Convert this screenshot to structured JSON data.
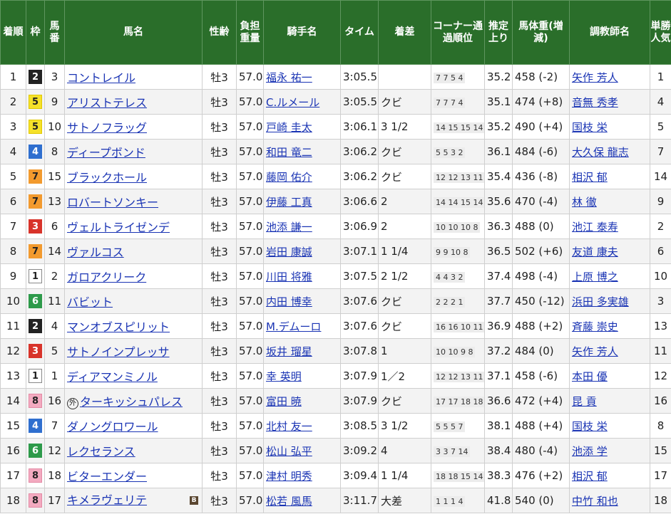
{
  "headers": {
    "rank": "着順",
    "waku": "枠",
    "umaban": "馬番",
    "horse": "馬名",
    "sexage": "性齢",
    "weight": "負担重量",
    "jockey": "騎手名",
    "time": "タイム",
    "margin": "着差",
    "corner": "コーナー通過順位",
    "last3f": "推定上り",
    "bodyweight": "馬体重(増減)",
    "trainer": "調教師名",
    "pop": "単勝人気"
  },
  "waku_colors": {
    "1": {
      "bg": "#ffffff",
      "fg": "#222222",
      "border": "#888888"
    },
    "2": {
      "bg": "#222222",
      "fg": "#ffffff",
      "border": "#222222"
    },
    "3": {
      "bg": "#d8332a",
      "fg": "#ffffff",
      "border": "#d8332a"
    },
    "4": {
      "bg": "#2f6fcf",
      "fg": "#ffffff",
      "border": "#2f6fcf"
    },
    "5": {
      "bg": "#f5e12a",
      "fg": "#222222",
      "border": "#e0c800"
    },
    "6": {
      "bg": "#2d9a4a",
      "fg": "#ffffff",
      "border": "#2d9a4a"
    },
    "7": {
      "bg": "#f29a2e",
      "fg": "#222222",
      "border": "#f29a2e"
    },
    "8": {
      "bg": "#f3aac0",
      "fg": "#222222",
      "border": "#e48aa5"
    }
  },
  "rows": [
    {
      "rank": "1",
      "waku": "2",
      "umaban": "3",
      "horse": "コントレイル",
      "sexage": "牡3",
      "weight": "57.0",
      "jockey": "福永 祐一",
      "time": "3:05.5",
      "margin": "",
      "corner": "7 7 5 4",
      "last3f": "35.2",
      "bodyweight": "458 (-2)",
      "trainer": "矢作 芳人",
      "pop": "1"
    },
    {
      "rank": "2",
      "waku": "5",
      "umaban": "9",
      "horse": "アリストテレス",
      "sexage": "牡3",
      "weight": "57.0",
      "jockey": "C.ルメール",
      "time": "3:05.5",
      "margin": "クビ",
      "corner": "7 7 7 4",
      "last3f": "35.1",
      "bodyweight": "474 (+8)",
      "trainer": "音無 秀孝",
      "pop": "4"
    },
    {
      "rank": "3",
      "waku": "5",
      "umaban": "10",
      "horse": "サトノフラッグ",
      "sexage": "牡3",
      "weight": "57.0",
      "jockey": "戸崎 圭太",
      "time": "3:06.1",
      "margin": "3 1/2",
      "corner": "14 15 15 14",
      "last3f": "35.2",
      "bodyweight": "490 (+4)",
      "trainer": "国枝 栄",
      "pop": "5"
    },
    {
      "rank": "4",
      "waku": "4",
      "umaban": "8",
      "horse": "ディープボンド",
      "sexage": "牡3",
      "weight": "57.0",
      "jockey": "和田 竜二",
      "time": "3:06.2",
      "margin": "クビ",
      "corner": "5 5 3 2",
      "last3f": "36.1",
      "bodyweight": "484 (-6)",
      "trainer": "大久保 龍志",
      "pop": "7"
    },
    {
      "rank": "5",
      "waku": "7",
      "umaban": "15",
      "horse": "ブラックホール",
      "sexage": "牡3",
      "weight": "57.0",
      "jockey": "藤岡 佑介",
      "time": "3:06.2",
      "margin": "クビ",
      "corner": "12 12 13 11",
      "last3f": "35.4",
      "bodyweight": "436 (-8)",
      "trainer": "相沢 郁",
      "pop": "14"
    },
    {
      "rank": "6",
      "waku": "7",
      "umaban": "13",
      "horse": "ロバートソンキー",
      "sexage": "牡3",
      "weight": "57.0",
      "jockey": "伊藤 工真",
      "time": "3:06.6",
      "margin": "2",
      "corner": "14 14 15 14",
      "last3f": "35.6",
      "bodyweight": "470 (-4)",
      "trainer": "林 徹",
      "pop": "9"
    },
    {
      "rank": "7",
      "waku": "3",
      "umaban": "6",
      "horse": "ヴェルトライゼンデ",
      "sexage": "牡3",
      "weight": "57.0",
      "jockey": "池添 謙一",
      "time": "3:06.9",
      "margin": "2",
      "corner": "10 10 10 8",
      "last3f": "36.3",
      "bodyweight": "488 (0)",
      "trainer": "池江 泰寿",
      "pop": "2"
    },
    {
      "rank": "8",
      "waku": "7",
      "umaban": "14",
      "horse": "ヴァルコス",
      "sexage": "牡3",
      "weight": "57.0",
      "jockey": "岩田 康誠",
      "time": "3:07.1",
      "margin": "1 1/4",
      "corner": "9 9 10 8",
      "last3f": "36.5",
      "bodyweight": "502 (+6)",
      "trainer": "友道 康夫",
      "pop": "6"
    },
    {
      "rank": "9",
      "waku": "1",
      "umaban": "2",
      "horse": "ガロアクリーク",
      "sexage": "牡3",
      "weight": "57.0",
      "jockey": "川田 将雅",
      "time": "3:07.5",
      "margin": "2 1/2",
      "corner": "4 4 3 2",
      "last3f": "37.4",
      "bodyweight": "498 (-4)",
      "trainer": "上原 博之",
      "pop": "10"
    },
    {
      "rank": "10",
      "waku": "6",
      "umaban": "11",
      "horse": "バビット",
      "sexage": "牡3",
      "weight": "57.0",
      "jockey": "内田 博幸",
      "time": "3:07.6",
      "margin": "クビ",
      "corner": "2 2 2 1",
      "last3f": "37.7",
      "bodyweight": "450 (-12)",
      "trainer": "浜田 多実雄",
      "pop": "3"
    },
    {
      "rank": "11",
      "waku": "2",
      "umaban": "4",
      "horse": "マンオブスピリット",
      "sexage": "牡3",
      "weight": "57.0",
      "jockey": "M.デムーロ",
      "time": "3:07.6",
      "margin": "クビ",
      "corner": "16 16 10 11",
      "last3f": "36.9",
      "bodyweight": "488 (+2)",
      "trainer": "斉藤 崇史",
      "pop": "13"
    },
    {
      "rank": "12",
      "waku": "3",
      "umaban": "5",
      "horse": "サトノインプレッサ",
      "sexage": "牡3",
      "weight": "57.0",
      "jockey": "坂井 瑠星",
      "time": "3:07.8",
      "margin": "1",
      "corner": "10 10 9 8",
      "last3f": "37.2",
      "bodyweight": "484 (0)",
      "trainer": "矢作 芳人",
      "pop": "11"
    },
    {
      "rank": "13",
      "waku": "1",
      "umaban": "1",
      "horse": "ディアマンミノル",
      "sexage": "牡3",
      "weight": "57.0",
      "jockey": "幸 英明",
      "time": "3:07.9",
      "margin": "1／2",
      "corner": "12 12 13 11",
      "last3f": "37.1",
      "bodyweight": "458 (-6)",
      "trainer": "本田 優",
      "pop": "12"
    },
    {
      "rank": "14",
      "waku": "8",
      "umaban": "16",
      "horse": "ターキッシュパレス",
      "gai": "外",
      "sexage": "牡3",
      "weight": "57.0",
      "jockey": "富田 暁",
      "time": "3:07.9",
      "margin": "クビ",
      "corner": "17 17 18 18",
      "last3f": "36.6",
      "bodyweight": "472 (+4)",
      "trainer": "昆 貢",
      "pop": "16"
    },
    {
      "rank": "15",
      "waku": "4",
      "umaban": "7",
      "horse": "ダノングロワール",
      "sexage": "牡3",
      "weight": "57.0",
      "jockey": "北村 友一",
      "time": "3:08.5",
      "margin": "3 1/2",
      "corner": "5 5 5 7",
      "last3f": "38.1",
      "bodyweight": "488 (+4)",
      "trainer": "国枝 栄",
      "pop": "8"
    },
    {
      "rank": "16",
      "waku": "6",
      "umaban": "12",
      "horse": "レクセランス",
      "sexage": "牡3",
      "weight": "57.0",
      "jockey": "松山 弘平",
      "time": "3:09.2",
      "margin": "4",
      "corner": "3 3 7 14",
      "last3f": "38.4",
      "bodyweight": "480 (-4)",
      "trainer": "池添 学",
      "pop": "15"
    },
    {
      "rank": "17",
      "waku": "8",
      "umaban": "18",
      "horse": "ビターエンダー",
      "sexage": "牡3",
      "weight": "57.0",
      "jockey": "津村 明秀",
      "time": "3:09.4",
      "margin": "1 1/4",
      "corner": "18 18 15 14",
      "last3f": "38.3",
      "bodyweight": "476 (+2)",
      "trainer": "相沢 郁",
      "pop": "17"
    },
    {
      "rank": "18",
      "waku": "8",
      "umaban": "17",
      "horse": "キメラヴェリテ",
      "blinker": "B",
      "sexage": "牡3",
      "weight": "57.0",
      "jockey": "松若 風馬",
      "time": "3:11.7",
      "margin": "大差",
      "corner": "1 1 1 4",
      "last3f": "41.8",
      "bodyweight": "540 (0)",
      "trainer": "中竹 和也",
      "pop": "18"
    }
  ]
}
